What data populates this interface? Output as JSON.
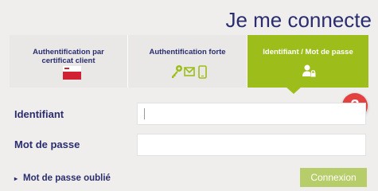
{
  "header": {
    "title": "Je me connecte"
  },
  "tabs": [
    {
      "label": "Authentification par certificat client",
      "icon": "flag-card-icon"
    },
    {
      "label": "Authentification forte",
      "icons": [
        "key-icon",
        "envelope-icon",
        "phone-icon"
      ]
    },
    {
      "label": "Identifiant / Mot de passe",
      "icon": "user-lock-icon",
      "active": true
    }
  ],
  "step_badge": "3",
  "form": {
    "identifiant_label": "Identifiant",
    "identifiant_value": "",
    "password_label": "Mot de passe",
    "password_value": ""
  },
  "forgot_password": {
    "arrow": "▸",
    "label": "Mot de passe oublié"
  },
  "submit_label": "Connexion",
  "colors": {
    "accent": "#9cbd1a",
    "text": "#2a2d6e",
    "badge": "#e34040"
  }
}
